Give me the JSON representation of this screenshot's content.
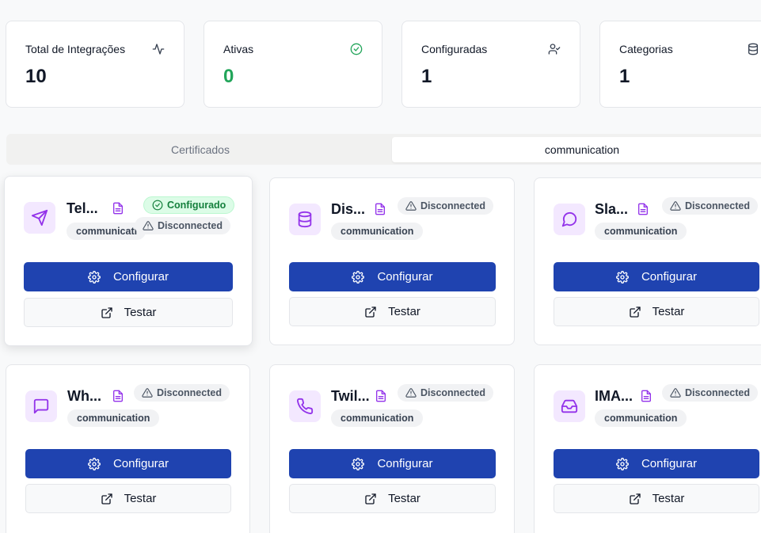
{
  "stats": [
    {
      "label": "Total de Integrações",
      "value": "10",
      "icon": "activity-icon"
    },
    {
      "label": "Ativas",
      "value": "0",
      "icon": "check-circle-icon",
      "color": "#22a55a"
    },
    {
      "label": "Configuradas",
      "value": "1",
      "icon": "user-check-icon"
    },
    {
      "label": "Categorias",
      "value": "1",
      "icon": "database-icon"
    }
  ],
  "tabs": [
    {
      "label": "Certificados",
      "active": false
    },
    {
      "label": "communication",
      "active": true
    }
  ],
  "integrations": [
    {
      "name": "Tel...",
      "category": "communicati",
      "icon": "send-icon",
      "status": "Disconnected",
      "configured_label": "Configurado"
    },
    {
      "name": "Dis...",
      "category": "communication",
      "icon": "database-icon",
      "status": "Disconnected"
    },
    {
      "name": "Sla...",
      "category": "communication",
      "icon": "message-circle-icon",
      "status": "Disconnected"
    },
    {
      "name": "Wh...",
      "category": "communication",
      "icon": "message-square-icon",
      "status": "Disconnected"
    },
    {
      "name": "Twil...",
      "category": "communication",
      "icon": "phone-icon",
      "status": "Disconnected"
    },
    {
      "name": "IMA...",
      "category": "communication",
      "icon": "inbox-icon",
      "status": "Disconnected"
    }
  ],
  "buttons": {
    "configure": "Configurar",
    "test": "Testar"
  },
  "colors": {
    "primary": "#1f43b0",
    "accent_purple": "#9333ea",
    "success": "#22a55a"
  }
}
